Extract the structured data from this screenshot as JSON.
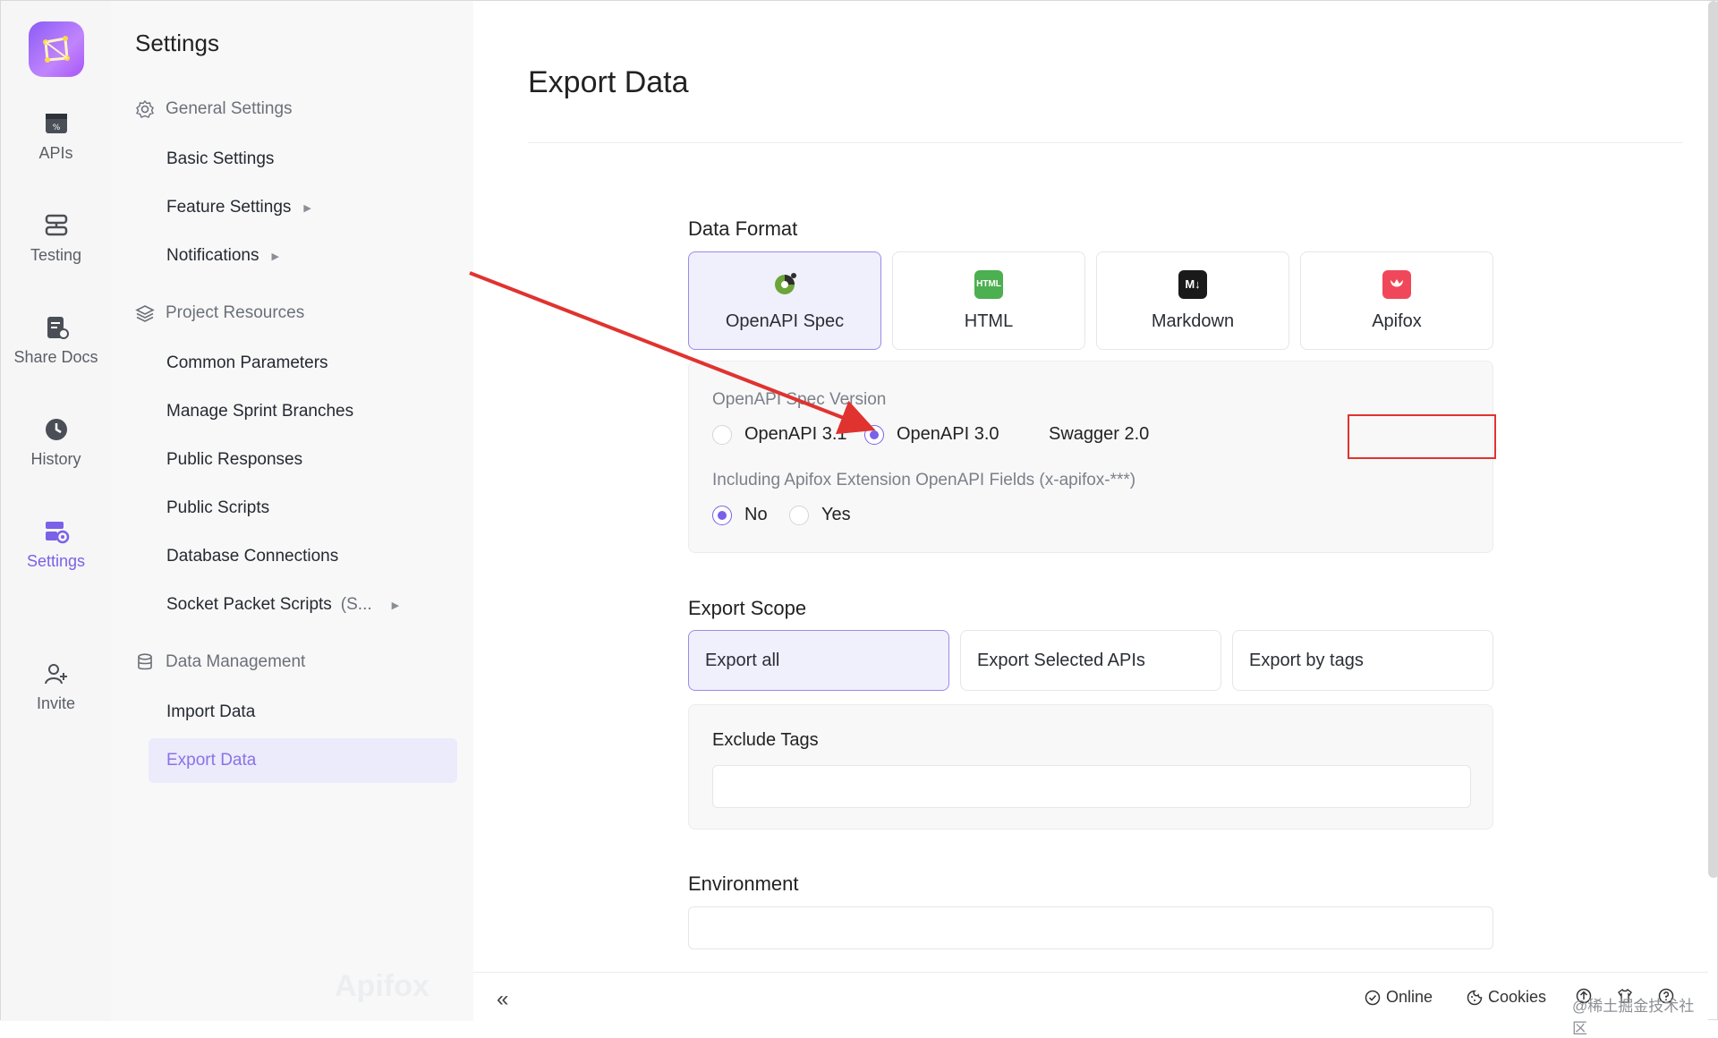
{
  "rail": {
    "items": [
      {
        "label": "APIs",
        "icon": "apis-icon"
      },
      {
        "label": "Testing",
        "icon": "testing-icon"
      },
      {
        "label": "Share Docs",
        "icon": "share-docs-icon"
      },
      {
        "label": "History",
        "icon": "history-icon"
      },
      {
        "label": "Settings",
        "icon": "settings-icon",
        "active": true
      },
      {
        "label": "Invite",
        "icon": "invite-icon"
      }
    ]
  },
  "nav": {
    "title": "Settings",
    "groups": [
      {
        "label": "General Settings",
        "icon": "gear-icon",
        "items": [
          "Basic Settings",
          "Feature Settings",
          "Notifications"
        ]
      },
      {
        "label": "Project Resources",
        "icon": "layers-icon",
        "items": [
          "Common Parameters",
          "Manage Sprint Branches",
          "Public Responses",
          "Public Scripts",
          "Database Connections",
          "Socket Packet Scripts"
        ]
      },
      {
        "label": "Data Management",
        "icon": "database-icon",
        "items": [
          "Import Data",
          "Export Data"
        ]
      }
    ],
    "socket_suffix": "(S...",
    "active_item": "Export Data",
    "watermark_logo": "Apifox"
  },
  "main": {
    "title": "Export Data",
    "data_format": {
      "label": "Data Format",
      "options": [
        "OpenAPI Spec",
        "HTML",
        "Markdown",
        "Apifox"
      ],
      "selected": "OpenAPI Spec",
      "icon_texts": {
        "html": "HTML",
        "markdown": "M↓"
      }
    },
    "spec_version": {
      "label": "OpenAPI Spec Version",
      "options": [
        "OpenAPI 3.1",
        "OpenAPI 3.0",
        "Swagger 2.0"
      ],
      "selected": "OpenAPI 3.0"
    },
    "extension": {
      "label": "Including Apifox Extension OpenAPI Fields (x-apifox-***)",
      "options": [
        "No",
        "Yes"
      ],
      "selected": "No"
    },
    "export_scope": {
      "label": "Export Scope",
      "options": [
        "Export all",
        "Export Selected APIs",
        "Export by tags"
      ],
      "selected": "Export all"
    },
    "exclude_tags": {
      "label": "Exclude Tags",
      "value": ""
    },
    "environment": {
      "label": "Environment",
      "value": ""
    }
  },
  "bottombar": {
    "collapse": "«",
    "online": "Online",
    "cookies": "Cookies",
    "watermark": "@稀土掘金技术社区"
  },
  "colors": {
    "accent": "#7b61e8",
    "annotation": "#e0332f"
  }
}
